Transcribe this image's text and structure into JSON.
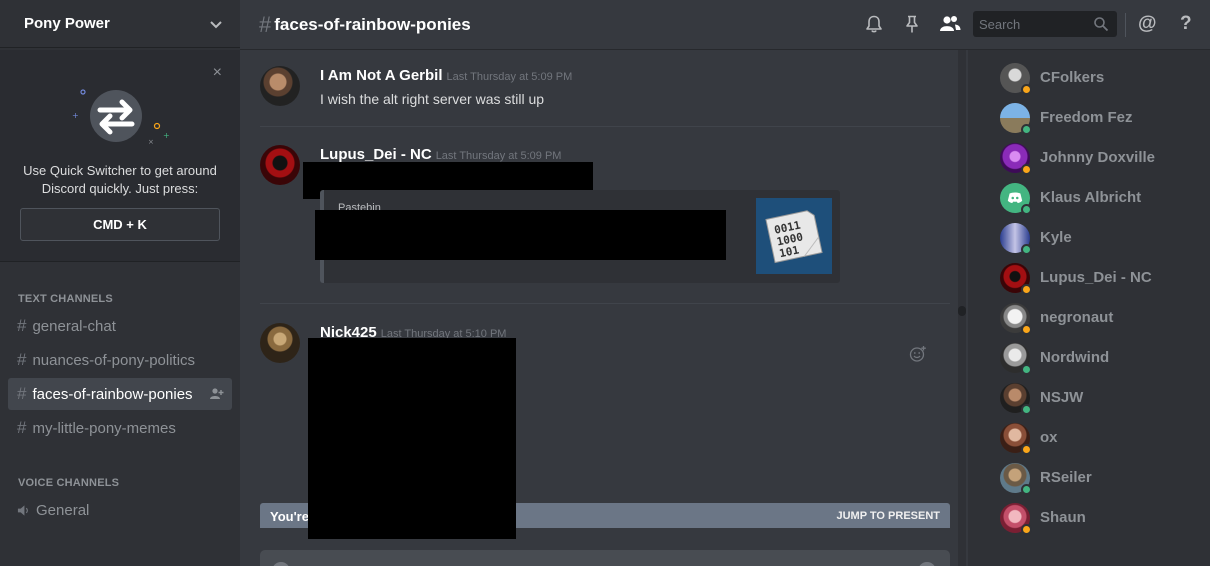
{
  "server": {
    "name": "Pony Power"
  },
  "quick_switcher": {
    "text": "Use Quick Switcher to get around Discord quickly. Just press:",
    "shortcut": "CMD + K",
    "close": "×"
  },
  "categories": {
    "text": "TEXT CHANNELS",
    "voice": "VOICE CHANNELS"
  },
  "text_channels": [
    {
      "name": "general-chat",
      "active": false
    },
    {
      "name": "nuances-of-pony-politics",
      "active": false
    },
    {
      "name": "faces-of-rainbow-ponies",
      "active": true
    },
    {
      "name": "my-little-pony-memes",
      "active": false
    }
  ],
  "voice_channels": [
    {
      "name": "General"
    }
  ],
  "header": {
    "hash": "#",
    "channel": "faces-of-rainbow-ponies",
    "search_placeholder": "Search",
    "mention": "@",
    "help": "?"
  },
  "messages": [
    {
      "author": "I Am Not A Gerbil",
      "timestamp": "Last Thursday at 5:09 PM",
      "text": "I wish the alt right server was still up"
    },
    {
      "author": "Lupus_Dei - NC",
      "timestamp": "Last Thursday at 5:09 PM",
      "embed_provider": "Pastebin"
    },
    {
      "author": "Nick425",
      "timestamp": "Last Thursday at 5:10 PM"
    }
  ],
  "jump_bar": {
    "note": "You're",
    "action": "JUMP TO PRESENT"
  },
  "members": [
    {
      "name": "CFolkers",
      "status": "idle"
    },
    {
      "name": "Freedom Fez",
      "status": "online"
    },
    {
      "name": "Johnny Doxville",
      "status": "idle"
    },
    {
      "name": "Klaus Albricht",
      "status": "online"
    },
    {
      "name": "Kyle",
      "status": "online"
    },
    {
      "name": "Lupus_Dei - NC",
      "status": "idle"
    },
    {
      "name": "negronaut",
      "status": "idle"
    },
    {
      "name": "Nordwind",
      "status": "online"
    },
    {
      "name": "NSJW",
      "status": "online"
    },
    {
      "name": "ox",
      "status": "idle"
    },
    {
      "name": "RSeiler",
      "status": "online"
    },
    {
      "name": "Shaun",
      "status": "idle"
    }
  ],
  "colors": {
    "online": "#43b581",
    "idle": "#faa61a",
    "background": "#36393f",
    "sidebar": "#2f3136"
  }
}
